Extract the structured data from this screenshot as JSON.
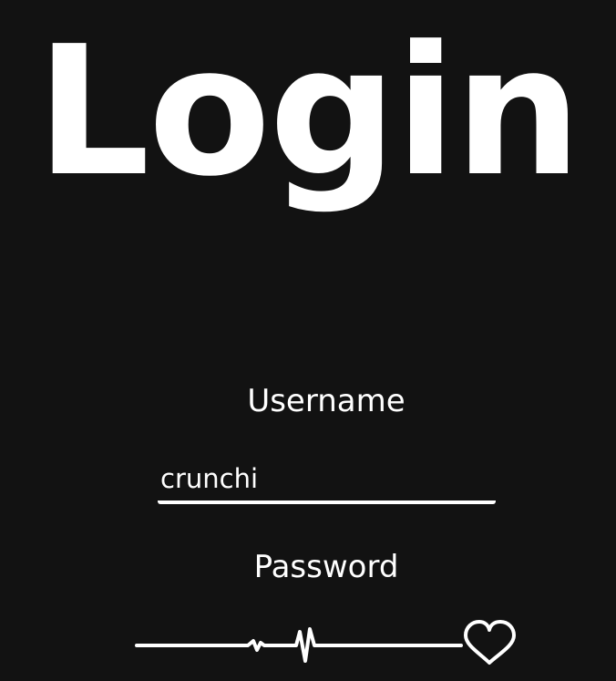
{
  "page": {
    "title": "Login"
  },
  "form": {
    "username_label": "Username",
    "username_value": "crunchi",
    "password_label": "Password"
  },
  "colors": {
    "background": "#121212",
    "foreground": "#ffffff"
  },
  "icons": {
    "password_field_decoration": "heartbeat-line-icon",
    "heart": "heart-icon"
  }
}
